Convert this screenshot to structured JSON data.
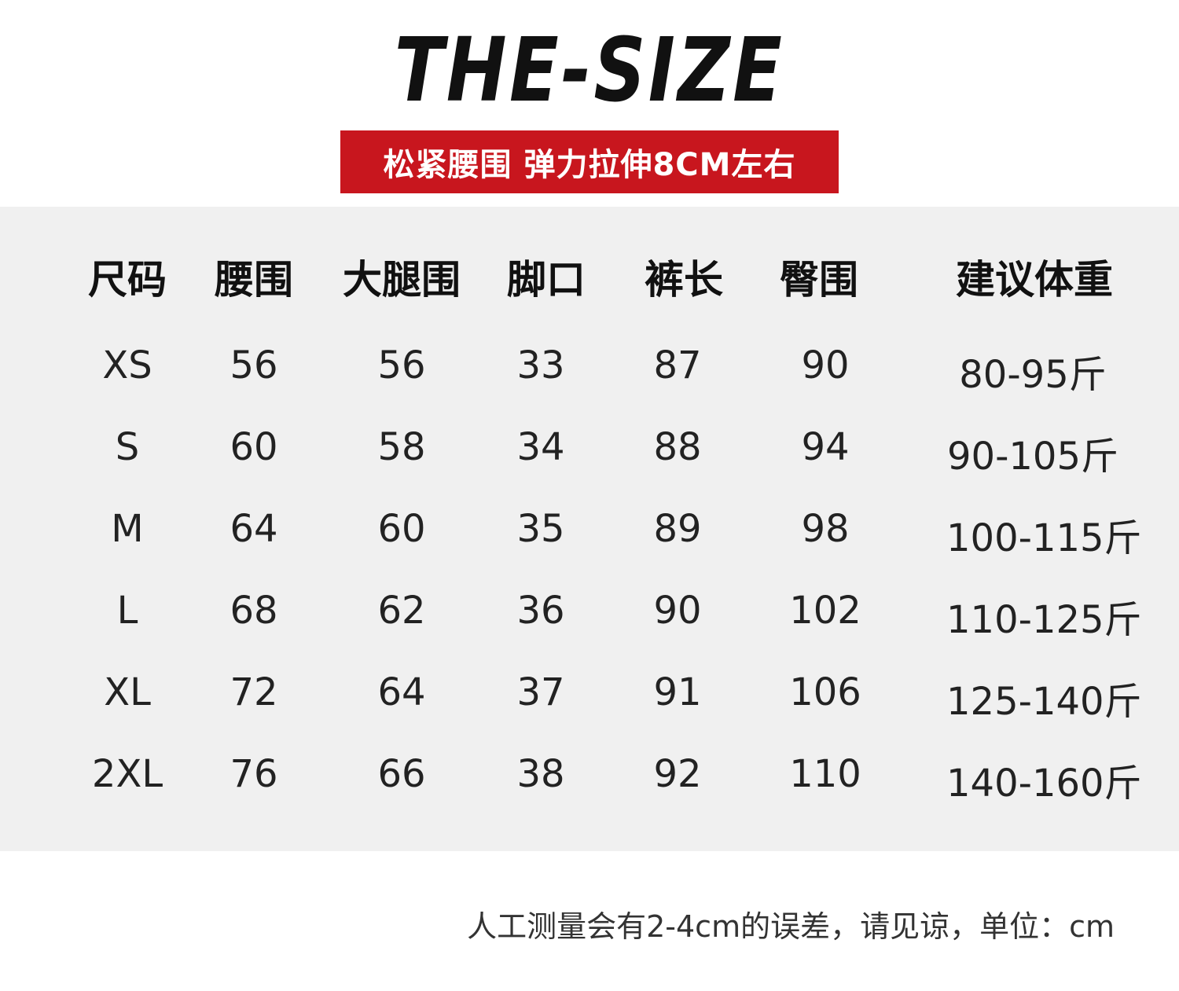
{
  "title": "THE-SIZE",
  "banner": "松紧腰围 弹力拉伸8CM左右",
  "table": {
    "headers": [
      "尺码",
      "腰围",
      "大腿围",
      "脚口",
      "裤长",
      "臀围",
      "建议体重"
    ],
    "rows": [
      [
        "XS",
        "56",
        "56",
        "33",
        "87",
        "90",
        "80-95斤"
      ],
      [
        "S",
        "60",
        "58",
        "34",
        "88",
        "94",
        "90-105斤"
      ],
      [
        "M",
        "64",
        "60",
        "35",
        "89",
        "98",
        "100-115斤"
      ],
      [
        "L",
        "68",
        "62",
        "36",
        "90",
        "102",
        "110-125斤"
      ],
      [
        "XL",
        "72",
        "64",
        "37",
        "91",
        "106",
        "125-140斤"
      ],
      [
        "2XL",
        "76",
        "66",
        "38",
        "92",
        "110",
        "140-160斤"
      ]
    ]
  },
  "note": "人工测量会有2-4cm的误差，请见谅，单位：cm",
  "colors": {
    "banner": "#c8161e",
    "panel": "#f0f0f0"
  }
}
